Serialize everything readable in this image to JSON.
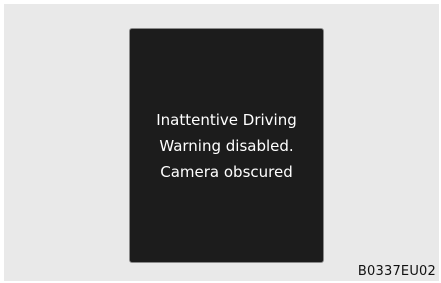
{
  "display": {
    "message_lines": [
      "Inattentive Driving",
      "Warning disabled.",
      "Camera obscured"
    ]
  },
  "figure_code": "B0337EU02"
}
